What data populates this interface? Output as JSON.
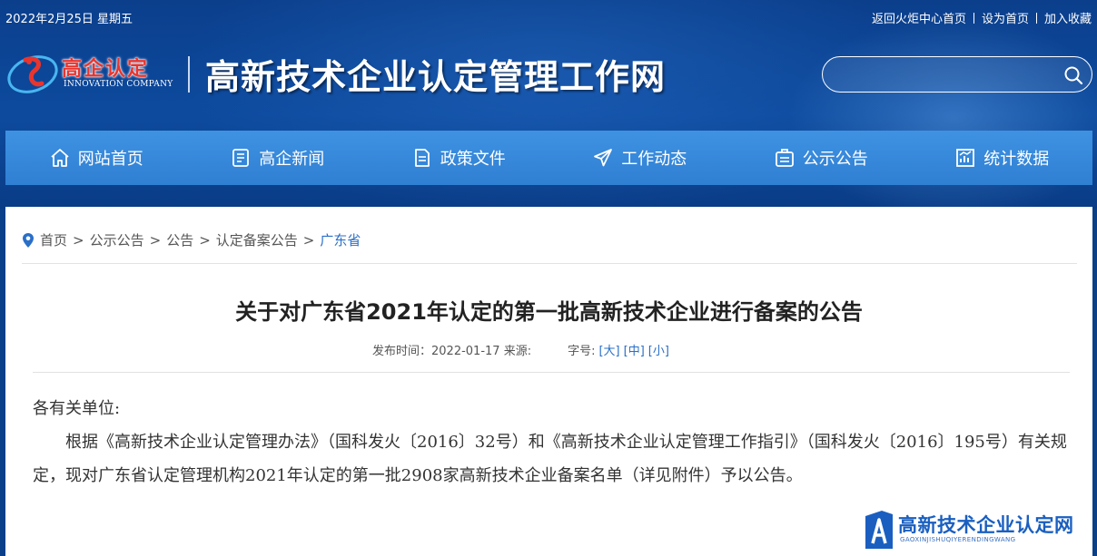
{
  "top_bar": {
    "date": "2022年2月25日 星期五",
    "links": [
      "返回火炬中心首页",
      "设为首页",
      "加入收藏"
    ]
  },
  "logo": {
    "cn": "高企认定",
    "en": "INNOVATION COMPANY"
  },
  "site_title": "高新技术企业认定管理工作网",
  "search": {
    "placeholder": ""
  },
  "nav": {
    "items": [
      {
        "label": "网站首页",
        "icon": "home-icon"
      },
      {
        "label": "高企新闻",
        "icon": "news-icon"
      },
      {
        "label": "政策文件",
        "icon": "document-icon"
      },
      {
        "label": "工作动态",
        "icon": "paper-plane-icon"
      },
      {
        "label": "公示公告",
        "icon": "notice-icon"
      },
      {
        "label": "统计数据",
        "icon": "chart-icon"
      }
    ]
  },
  "breadcrumb": {
    "items": [
      "首页",
      "公示公告",
      "公告",
      "认定备案公告"
    ],
    "separator": ">",
    "current": "广东省"
  },
  "article": {
    "title": "关于对广东省2021年认定的第一批高新技术企业进行备案的公告",
    "publish_label": "发布时间：2022-01-17",
    "source_label": "来源:",
    "font_label": "字号:",
    "size_large": "[大]",
    "size_medium": "[中]",
    "size_small": "[小]",
    "salutation": "各有关单位:",
    "paragraph": "根据《高新技术企业认定管理办法》（国科发火〔2016〕32号）和《高新技术企业认定管理工作指引》（国科发火〔2016〕195号）有关规定，现对广东省认定管理机构2021年认定的第一批2908家高新技术企业备案名单（详见附件）予以公告。"
  },
  "watermark": {
    "text": "高新技术企业认定网",
    "sub": "GAOXINJISHUQIYERENDINGWANG"
  },
  "colors": {
    "header_bg": "#0b3f8c",
    "nav_bg": "#3f92e2",
    "link_blue": "#2a6fc8",
    "logo_red": "#e8352e"
  }
}
